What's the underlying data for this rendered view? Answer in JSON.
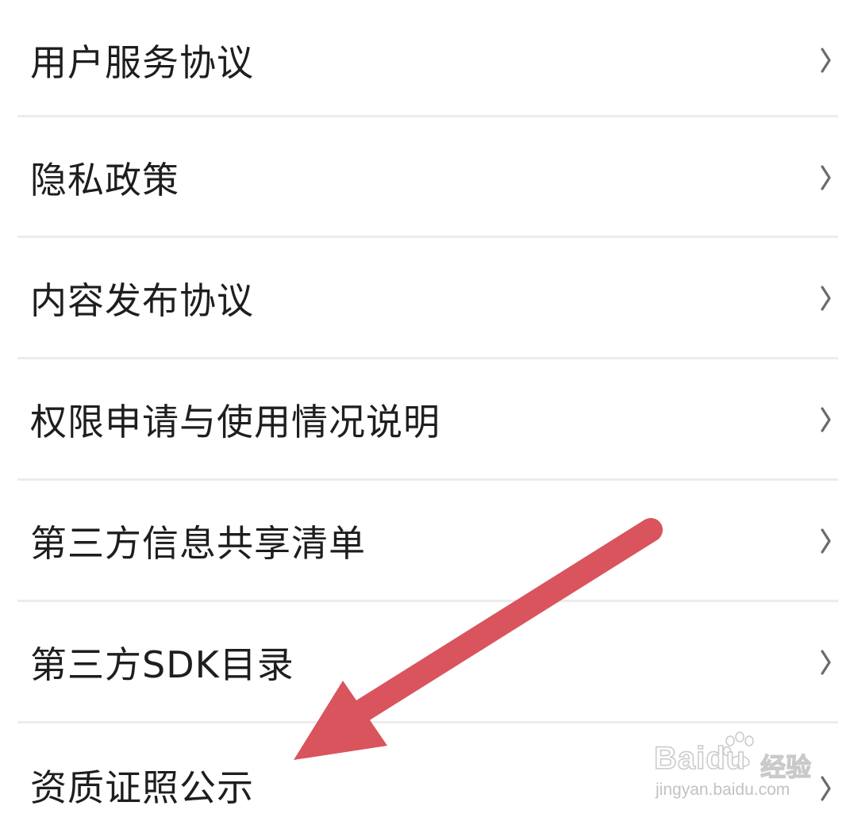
{
  "menu": {
    "items": [
      {
        "label": "用户服务协议"
      },
      {
        "label": "隐私政策"
      },
      {
        "label": "内容发布协议"
      },
      {
        "label": "权限申请与使用情况说明"
      },
      {
        "label": "第三方信息共享清单"
      },
      {
        "label": "第三方SDK目录"
      },
      {
        "label": "资质证照公示"
      }
    ]
  },
  "icons": {
    "row_trailing": "chevron-right-icon",
    "annotation": "red-arrow-annotation"
  },
  "colors": {
    "text": "#1e1e1e",
    "chevron": "#6b6b6b",
    "divider": "#ececec",
    "arrow": "#d9545c"
  },
  "watermark": {
    "brand": "Baidu",
    "brand_cn": "经验",
    "url": "jingyan.baidu.com"
  }
}
